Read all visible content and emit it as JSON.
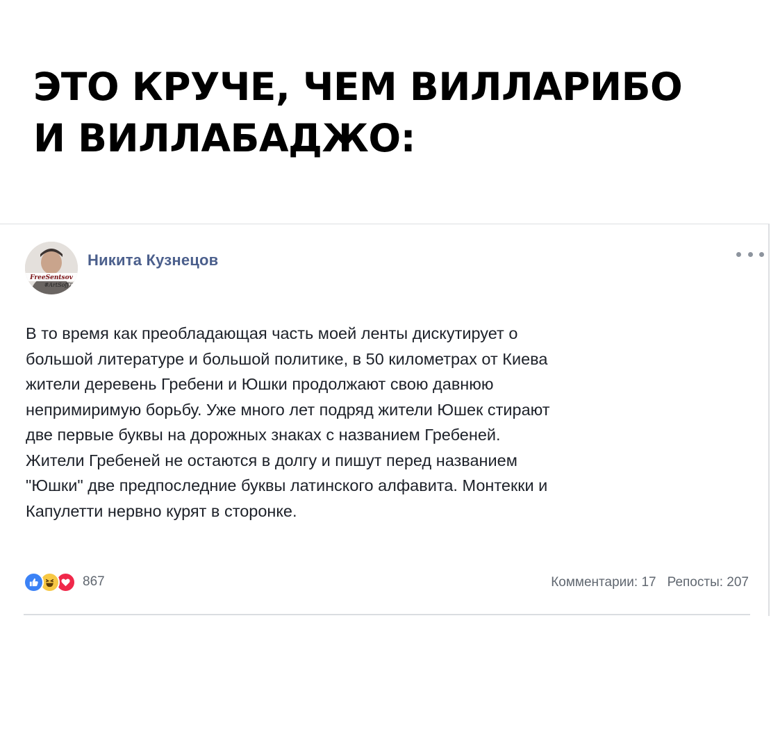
{
  "meme": {
    "title_line1": "ЭТО КРУЧЕ, ЧЕМ ВИЛЛАРИБО",
    "title_line2": "И ВИЛЛАБАДЖО:"
  },
  "post": {
    "author": "Никита Кузнецов",
    "avatar_caption_line1": "FreeSentsov",
    "avatar_caption_line2": "#ArtSoffT",
    "text_lines": [
      "В то время как преобладающая часть моей ленты дискутирует о",
      "большой литературе и большой политике, в 50 километрах от Киева",
      "жители деревень Гребени и Юшки продолжают свою давнюю",
      "непримиримую борьбу. Уже много лет подряд жители Юшек стирают",
      "две первые буквы на дорожных знаках с названием Гребеней.",
      "Жители Гребеней не остаются в долгу и пишут перед названием",
      "\"Юшки\" две предпоследние буквы латинского алфавита. Монтекки и",
      "Капулетти нервно курят в сторонке."
    ],
    "reactions": {
      "icons": [
        "like-icon",
        "haha-icon",
        "love-icon"
      ],
      "count": "867"
    },
    "comments": "Комментарии: 17",
    "reposts": "Репосты: 207"
  },
  "colors": {
    "author": "#4b5f8c",
    "like": "#3b82f6",
    "haha": "#f7c844",
    "love": "#f0284a"
  }
}
